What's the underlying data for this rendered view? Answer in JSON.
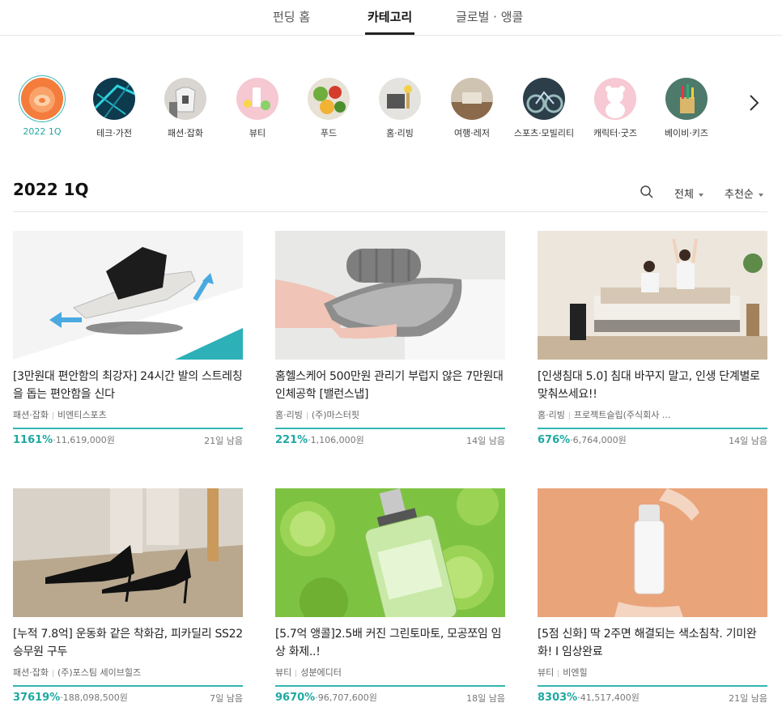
{
  "nav": {
    "tabs": [
      {
        "label": "펀딩 홈",
        "active": false
      },
      {
        "label": "카테고리",
        "active": true
      },
      {
        "label": "글로벌 · 앵콜",
        "active": false
      }
    ]
  },
  "categories": [
    {
      "label": "2022 1Q",
      "active": true,
      "icon": "orange-slice-icon"
    },
    {
      "label": "테크·가전",
      "active": false,
      "icon": "tech-icon"
    },
    {
      "label": "패션·잡화",
      "active": false,
      "icon": "fashion-icon"
    },
    {
      "label": "뷰티",
      "active": false,
      "icon": "beauty-icon"
    },
    {
      "label": "푸드",
      "active": false,
      "icon": "food-icon"
    },
    {
      "label": "홈·리빙",
      "active": false,
      "icon": "home-icon"
    },
    {
      "label": "여행·레저",
      "active": false,
      "icon": "travel-icon"
    },
    {
      "label": "스포츠·모빌리티",
      "active": false,
      "icon": "sports-icon"
    },
    {
      "label": "캐릭터·굿즈",
      "active": false,
      "icon": "character-icon"
    },
    {
      "label": "베이비·키즈",
      "active": false,
      "icon": "kids-icon"
    }
  ],
  "section": {
    "title": "2022 1Q",
    "filter_label": "전체",
    "sort_label": "추천순"
  },
  "colors": {
    "accent": "#35b6b1",
    "accent_text": "#1fa8a2"
  },
  "projects": [
    {
      "title": "[3만원대 편안함의 최강자] 24시간 발의 스트레칭을 돕는 편안함을 신다",
      "category": "패션·잡화",
      "maker": "비엔티스포츠",
      "percent": "1161%",
      "amount": "11,619,000원",
      "days_left": "21일 남음",
      "progress": 1.0
    },
    {
      "title": "홈헬스케어 500만원 관리기 부럽지 않은 7만원대 인체공학 [밸런스냅]",
      "category": "홈·리빙",
      "maker": "(주)마스터핏",
      "percent": "221%",
      "amount": "1,106,000원",
      "days_left": "14일 남음",
      "progress": 1.0
    },
    {
      "title": "[인생침대 5.0] 침대 바꾸지 말고, 인생 단계별로 맞춰쓰세요!!",
      "category": "홈·리빙",
      "maker": "프로젝트슬립(주식회사 ...",
      "percent": "676%",
      "amount": "6,764,000원",
      "days_left": "14일 남음",
      "progress": 1.0
    },
    {
      "title": "[누적 7.8억] 운동화 같은 착화감, 피카딜리 SS22 승무원 구두",
      "category": "패션·잡화",
      "maker": "(주)포스팀 세이브힐즈",
      "percent": "37619%",
      "amount": "188,098,500원",
      "days_left": "7일 남음",
      "progress": 1.0
    },
    {
      "title": "[5.7억 앵콜]2.5배 커진 그린토마토, 모공쪼임 임상 화제..!",
      "category": "뷰티",
      "maker": "성분에디터",
      "percent": "9670%",
      "amount": "96,707,600원",
      "days_left": "18일 남음",
      "progress": 1.0
    },
    {
      "title": "[5점 신화] 딱 2주면 해결되는 색소침착. 기미완화! I 임상완료",
      "category": "뷰티",
      "maker": "비엔힐",
      "percent": "8303%",
      "amount": "41,517,400원",
      "days_left": "21일 남음",
      "progress": 1.0
    }
  ]
}
